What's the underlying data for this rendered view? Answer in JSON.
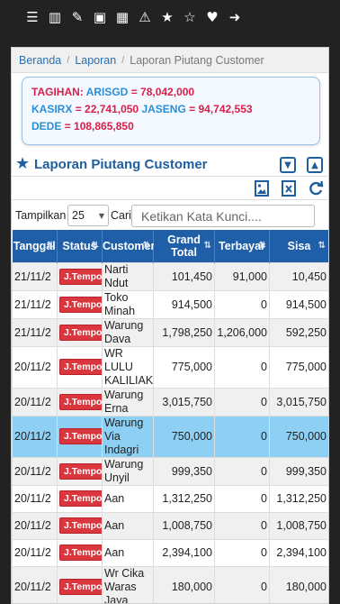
{
  "topbar": {
    "icons": [
      "menu-icon",
      "barcode-icon",
      "edit-icon",
      "money-icon",
      "calendar-icon",
      "warning-icon",
      "star-icon",
      "star-outline-icon",
      "heart-icon",
      "logout-icon"
    ],
    "glyphs": [
      "☰",
      "▥",
      "✎",
      "▣",
      "▦",
      "⚠",
      "★",
      "☆",
      "♥",
      "➜"
    ]
  },
  "breadcrumb": {
    "home": "Beranda",
    "section": "Laporan",
    "current": "Laporan Piutang Customer"
  },
  "summary": {
    "tagihan_label": "TAGIHAN:",
    "arisgd_label": "ARISGD",
    "arisgd_value": "= 78,042,000",
    "kasirx_label": "KASIRX",
    "kasirx_value": "= 22,741,050",
    "jaseng_label": "JASENG",
    "jaseng_value": "= 94,742,553",
    "dede_label": "DEDE",
    "dede_value": "= 108,865,850"
  },
  "panel": {
    "title": "Laporan Piutang Customer"
  },
  "filter": {
    "show_label": "Tampilkan",
    "page_size": "25",
    "search_label": "Cari",
    "search_placeholder": "Ketikan Kata Kunci...."
  },
  "table": {
    "headers": [
      "Tanggal",
      "Status",
      "Customer",
      "Grand Total",
      "Terbayar",
      "Sisa"
    ],
    "rows": [
      {
        "tanggal": "21/11/2",
        "status": "J.Tempo",
        "customer": "Narti Ndut",
        "grand_total": "101,450",
        "terbayar": "91,000",
        "sisa": "10,450"
      },
      {
        "tanggal": "21/11/2",
        "status": "J.Tempo",
        "customer": "Toko Minah",
        "grand_total": "914,500",
        "terbayar": "0",
        "sisa": "914,500"
      },
      {
        "tanggal": "21/11/2",
        "status": "J.Tempo",
        "customer": "Warung Dava",
        "grand_total": "1,798,250",
        "terbayar": "1,206,000",
        "sisa": "592,250"
      },
      {
        "tanggal": "20/11/2",
        "status": "J.Tempo",
        "customer": "WR LULU KALILIAK",
        "grand_total": "775,000",
        "terbayar": "0",
        "sisa": "775,000"
      },
      {
        "tanggal": "20/11/2",
        "status": "J.Tempo",
        "customer": "Warung Erna",
        "grand_total": "3,015,750",
        "terbayar": "0",
        "sisa": "3,015,750"
      },
      {
        "tanggal": "20/11/2",
        "status": "J.Tempo",
        "customer": "Warung Via Indagri",
        "grand_total": "750,000",
        "terbayar": "0",
        "sisa": "750,000"
      },
      {
        "tanggal": "20/11/2",
        "status": "J.Tempo",
        "customer": "Warung Unyil",
        "grand_total": "999,350",
        "terbayar": "0",
        "sisa": "999,350"
      },
      {
        "tanggal": "20/11/2",
        "status": "J.Tempo",
        "customer": "Aan",
        "grand_total": "1,312,250",
        "terbayar": "0",
        "sisa": "1,312,250"
      },
      {
        "tanggal": "20/11/2",
        "status": "J.Tempo",
        "customer": "Aan",
        "grand_total": "1,008,750",
        "terbayar": "0",
        "sisa": "1,008,750"
      },
      {
        "tanggal": "20/11/2",
        "status": "J.Tempo",
        "customer": "Aan",
        "grand_total": "2,394,100",
        "terbayar": "0",
        "sisa": "2,394,100"
      },
      {
        "tanggal": "20/11/2",
        "status": "J.Tempo",
        "customer": "Wr Cika Waras Jaya",
        "grand_total": "180,000",
        "terbayar": "0",
        "sisa": "180,000"
      }
    ]
  }
}
